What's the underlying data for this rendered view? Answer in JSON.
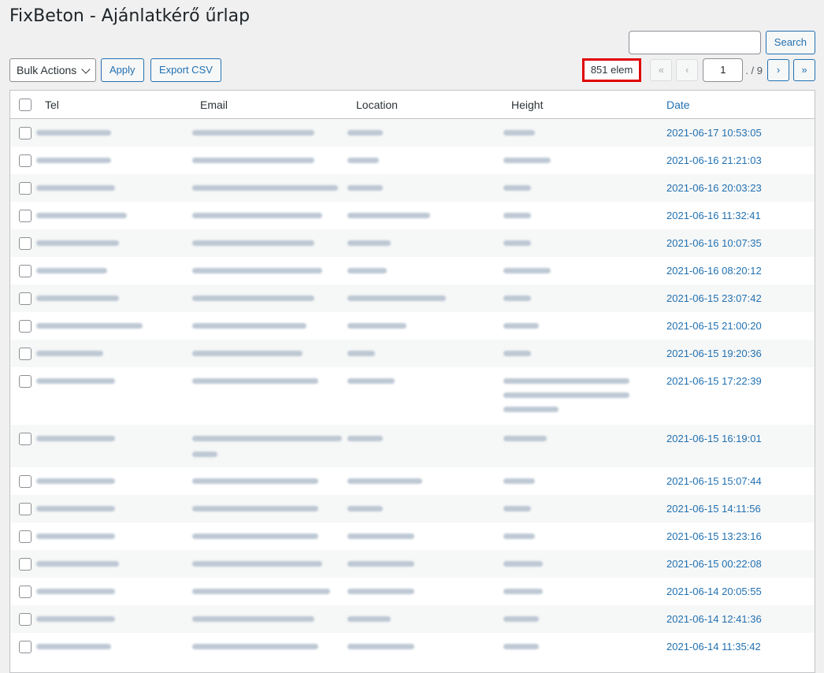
{
  "page": {
    "title": "FixBeton - Ajánlatkérő űrlap"
  },
  "search": {
    "placeholder": "",
    "button_label": "Search"
  },
  "toolbar": {
    "bulk_actions_label": "Bulk Actions",
    "apply_label": "Apply",
    "export_label": "Export CSV"
  },
  "pagination": {
    "item_count": "851 elem",
    "first_label": "«",
    "prev_label": "‹",
    "current_page": "1",
    "total_label": ". / 9",
    "next_label": "›",
    "last_label": "»"
  },
  "table": {
    "columns": {
      "tel": "Tel",
      "email": "Email",
      "location": "Location",
      "height": "Height",
      "date": "Date"
    },
    "rows": [
      {
        "date": "2021-06-17 10:53:05"
      },
      {
        "date": "2021-06-16 21:21:03"
      },
      {
        "date": "2021-06-16 20:03:23"
      },
      {
        "date": "2021-06-16 11:32:41"
      },
      {
        "date": "2021-06-16 10:07:35"
      },
      {
        "date": "2021-06-16 08:20:12"
      },
      {
        "date": "2021-06-15 23:07:42"
      },
      {
        "date": "2021-06-15 21:00:20"
      },
      {
        "date": "2021-06-15 19:20:36"
      },
      {
        "date": "2021-06-15 17:22:39"
      },
      {
        "date": "2021-06-15 16:19:01"
      },
      {
        "date": "2021-06-15 15:07:44"
      },
      {
        "date": "2021-06-15 14:11:56"
      },
      {
        "date": "2021-06-15 13:23:16"
      },
      {
        "date": "2021-06-15 00:22:08"
      },
      {
        "date": "2021-06-14 20:05:55"
      },
      {
        "date": "2021-06-14 12:41:36"
      },
      {
        "date": "2021-06-14 11:35:42"
      }
    ]
  },
  "colors": {
    "accent": "#2271b1",
    "highlight_border": "#e00000",
    "background": "#f0f0f1"
  }
}
